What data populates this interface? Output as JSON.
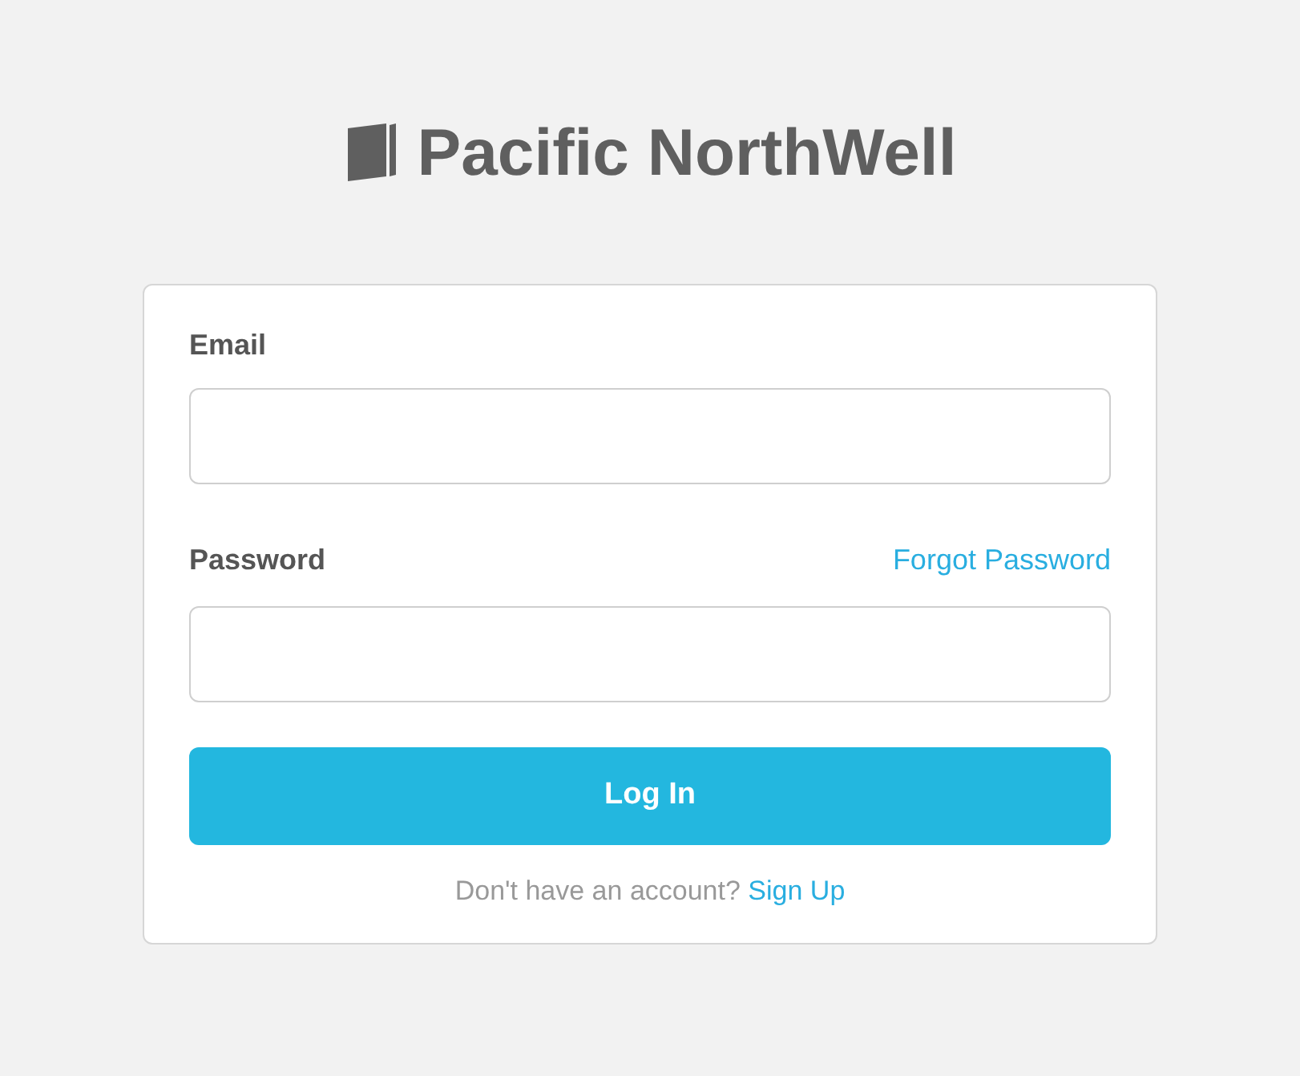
{
  "brand": {
    "name": "Pacific NorthWell"
  },
  "form": {
    "email": {
      "label": "Email"
    },
    "password": {
      "label": "Password",
      "forgot_link": "Forgot Password"
    },
    "submit": "Log In",
    "signup": {
      "prompt": "Don't have an account?",
      "link": "Sign Up"
    }
  }
}
